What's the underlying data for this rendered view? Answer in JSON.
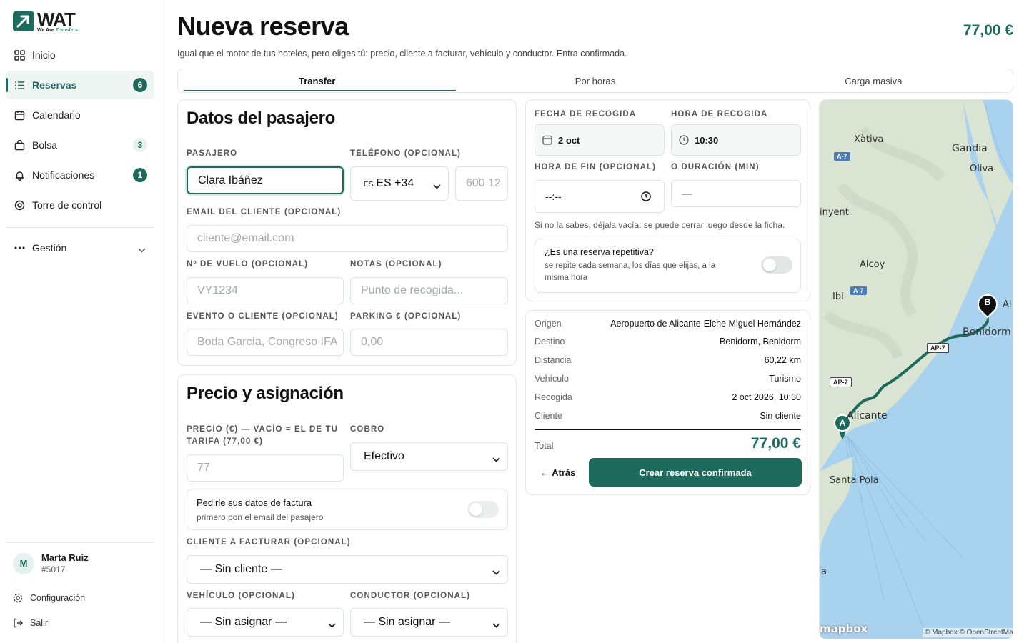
{
  "brand": {
    "name": "WAT",
    "tagline_a": "We Are",
    "tagline_b": "Transfers"
  },
  "nav": {
    "items": [
      {
        "label": "Inicio",
        "icon": "grid-icon"
      },
      {
        "label": "Reservas",
        "icon": "list-icon",
        "badge": "6",
        "active": true
      },
      {
        "label": "Calendario",
        "icon": "calendar-icon"
      },
      {
        "label": "Bolsa",
        "icon": "bag-icon",
        "badge": "3"
      },
      {
        "label": "Notificaciones",
        "icon": "bell-icon",
        "badge": "1"
      },
      {
        "label": "Torre de control",
        "icon": "target-icon"
      }
    ],
    "gestion": "Gestión"
  },
  "user": {
    "initial": "M",
    "name": "Marta Ruiz",
    "id": "#5017"
  },
  "footer": {
    "config": "Configuración",
    "logout": "Salir"
  },
  "header": {
    "title": "Nueva reserva",
    "subtitle": "Igual que el motor de tus hoteles, pero eliges tú: precio, cliente a facturar, vehículo y conductor. Entra confirmada.",
    "price": "77,00 €"
  },
  "tabs": [
    "Transfer",
    "Por horas",
    "Carga masiva"
  ],
  "passenger": {
    "title": "Datos del pasajero",
    "name_label": "Pasajero",
    "name_value": "Clara Ibáñez",
    "phone_label": "Teléfono (opcional)",
    "phone_prefix": "ES +34",
    "phone_flag": "ES",
    "phone_placeholder": "600 12",
    "email_label": "Email del cliente (opcional)",
    "email_placeholder": "cliente@email.com",
    "flight_label": "Nº de vuelo (opcional)",
    "flight_placeholder": "VY1234",
    "notes_label": "Notas (opcional)",
    "notes_placeholder": "Punto de recogida...",
    "event_label": "Evento o cliente (opcional)",
    "event_placeholder": "Boda García, Congreso IFA",
    "parking_label": "Parking € (opcional)",
    "parking_placeholder": "0,00"
  },
  "pricing": {
    "title": "Precio y asignación",
    "price_label_1": "Precio (€) — vacío = el de tu",
    "price_label_2": "tarifa (77,00 €)",
    "price_placeholder": "77",
    "payment_label": "Cobro",
    "payment_value": "Efectivo",
    "invoice_title": "Pedirle sus datos de factura",
    "invoice_sub": "primero pon el email del pasajero",
    "invoice_on": false,
    "bill_client_label": "Cliente a facturar (opcional)",
    "bill_client_value": "— Sin cliente —",
    "vehicle_label": "Vehículo (opcional)",
    "vehicle_value": "— Sin asignar —",
    "driver_label": "Conductor (opcional)",
    "driver_value": "— Sin asignar —"
  },
  "pickup": {
    "date_label": "Fecha de recogida",
    "date_value": "2 oct",
    "time_label": "Hora de recogida",
    "time_value": "10:30",
    "end_label": "Hora de fin (opcional)",
    "end_value": "--:--",
    "duration_label": "o duración (min)",
    "duration_placeholder": "—",
    "hint": "Si no la sabes, déjala vacía: se puede cerrar luego desde la ficha.",
    "repeat_title": "¿Es una reserva repetitiva?",
    "repeat_sub_1": "se repite cada semana, los días que elijas, a la",
    "repeat_sub_2": "misma hora",
    "repeat_on": false
  },
  "summary": {
    "rows": [
      {
        "k": "Origen",
        "v": "Aeropuerto de Alicante-Elche Miguel Hernández"
      },
      {
        "k": "Destino",
        "v": "Benidorm, Benidorm"
      },
      {
        "k": "Distancia",
        "v": "60,22 km"
      },
      {
        "k": "Vehículo",
        "v": "Turismo"
      },
      {
        "k": "Recogida",
        "v": "2 oct 2026, 10:30"
      },
      {
        "k": "Cliente",
        "v": "Sin cliente"
      }
    ],
    "total_label": "Total",
    "total_value": "77,00 €",
    "back": "← Atrás",
    "submit": "Crear reserva confirmada"
  },
  "map": {
    "labels": [
      "Xàtiva",
      "Gandia",
      "Oliva",
      "inyent",
      "Alcoy",
      "Ibi",
      "Al",
      "Benidorm",
      "Alicante",
      "Santa Pola",
      "a"
    ],
    "roads": [
      "A-7",
      "A-7",
      "AP-7",
      "AP-7"
    ],
    "marker_a": "A",
    "marker_b": "B",
    "logo": "mapbox",
    "attribution": "© Mapbox © OpenStreetMap"
  },
  "colors": {
    "brand": "#1e6b5e",
    "accent_light": "#eef5f3"
  }
}
